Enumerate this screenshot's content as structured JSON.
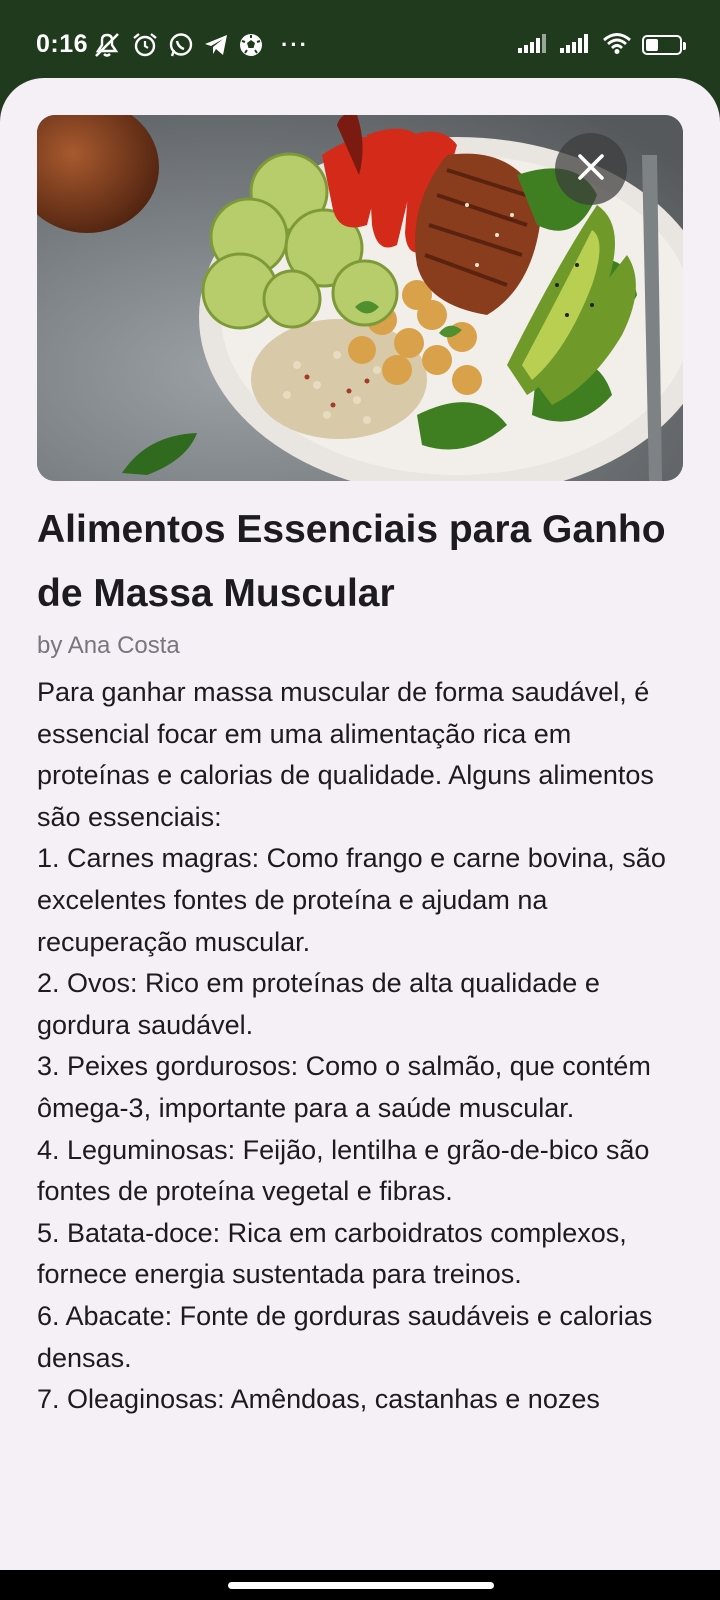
{
  "status_bar": {
    "time": "0:16",
    "left_icons": [
      "mute-icon",
      "alarm-icon",
      "whatsapp-icon",
      "telegram-icon",
      "soccer-ball-icon"
    ],
    "more": "···",
    "right_icons": [
      "signal-icon",
      "signal-icon",
      "wifi-icon"
    ],
    "battery_level": "39"
  },
  "article": {
    "image_subject": "bowl with chicken, quinoa, chickpeas, brussels sprouts, red pepper, avocado and spinach",
    "title": "Alimentos Essenciais para Ganho de Massa Muscular",
    "author": "by Ana Costa",
    "paragraphs": [
      "Para ganhar massa muscular de forma saudável, é essencial focar em uma alimentação rica em proteínas e calorias de qualidade. Alguns alimentos são essenciais:",
      "1. Carnes magras: Como frango e carne bovina, são excelentes fontes de proteína e ajudam na recuperação muscular.",
      "2. Ovos: Rico em proteínas de alta qualidade e gordura saudável.",
      "3. Peixes gordurosos: Como o salmão, que contém ômega-3, importante para a saúde muscular.",
      "4. Leguminosas: Feijão, lentilha e grão-de-bico são fontes de proteína vegetal e fibras.",
      "5. Batata-doce: Rica em carboidratos complexos, fornece energia sustentada para treinos.",
      "6. Abacate: Fonte de gorduras saudáveis e calorias densas.",
      "7. Oleaginosas: Amêndoas, castanhas e nozes"
    ]
  },
  "colors": {
    "status_bar": "#1f3a1c",
    "sheet_background": "#f5eff6",
    "text_primary": "#1d1b20",
    "text_secondary": "#79747e"
  }
}
